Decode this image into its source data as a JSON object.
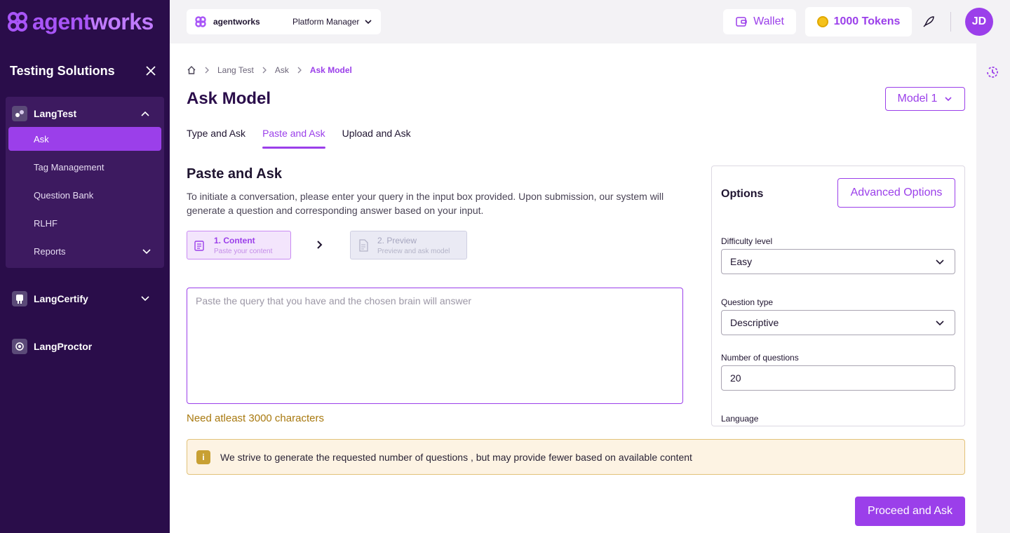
{
  "brand": {
    "logo_text_a": "agent",
    "logo_text_b": "works"
  },
  "sidebar": {
    "title": "Testing Solutions",
    "groups": [
      {
        "label": "LangTest",
        "expanded": true
      },
      {
        "label": "LangCertify",
        "expanded": false
      },
      {
        "label": "LangProctor",
        "expanded": false
      }
    ],
    "langtest_items": [
      {
        "label": "Ask",
        "active": true
      },
      {
        "label": "Tag Management"
      },
      {
        "label": "Question Bank"
      },
      {
        "label": "RLHF"
      },
      {
        "label": "Reports"
      }
    ]
  },
  "topbar": {
    "org_name": "agentworks",
    "org_role": "Platform Manager",
    "wallet_label": "Wallet",
    "tokens_label": "1000 Tokens",
    "avatar_initials": "JD"
  },
  "breadcrumb": [
    "Lang Test",
    "Ask",
    "Ask Model"
  ],
  "page": {
    "title": "Ask Model",
    "model_button": "Model 1",
    "tabs": [
      {
        "label": "Type and Ask"
      },
      {
        "label": "Paste and Ask",
        "active": true
      },
      {
        "label": "Upload and Ask"
      }
    ],
    "section_title": "Paste and Ask",
    "section_desc": "To initiate a conversation, please enter your query in the input box provided. Upon submission, our system will generate a question and corresponding answer based on your input.",
    "steps": [
      {
        "title": "1. Content",
        "sub": "Paste your content"
      },
      {
        "title": "2.  Preview",
        "sub": "Preview and ask model"
      }
    ],
    "query_placeholder": "Paste the query that you have and the chosen brain will answer",
    "char_warning": "Need atleast 3000 characters",
    "info_text": "We strive to generate the requested number of questions , but may provide fewer based on available content",
    "proceed_button": "Proceed and Ask"
  },
  "options": {
    "title": "Options",
    "advanced_button": "Advanced Options",
    "difficulty_label": "Difficulty level",
    "difficulty_value": "Easy",
    "qtype_label": "Question type",
    "qtype_value": "Descriptive",
    "count_label": "Number of questions",
    "count_value": "20",
    "language_label": "Language"
  },
  "colors": {
    "accent": "#9b3fea",
    "sidebar": "#2a0d4a",
    "warning": "#a8790f"
  }
}
